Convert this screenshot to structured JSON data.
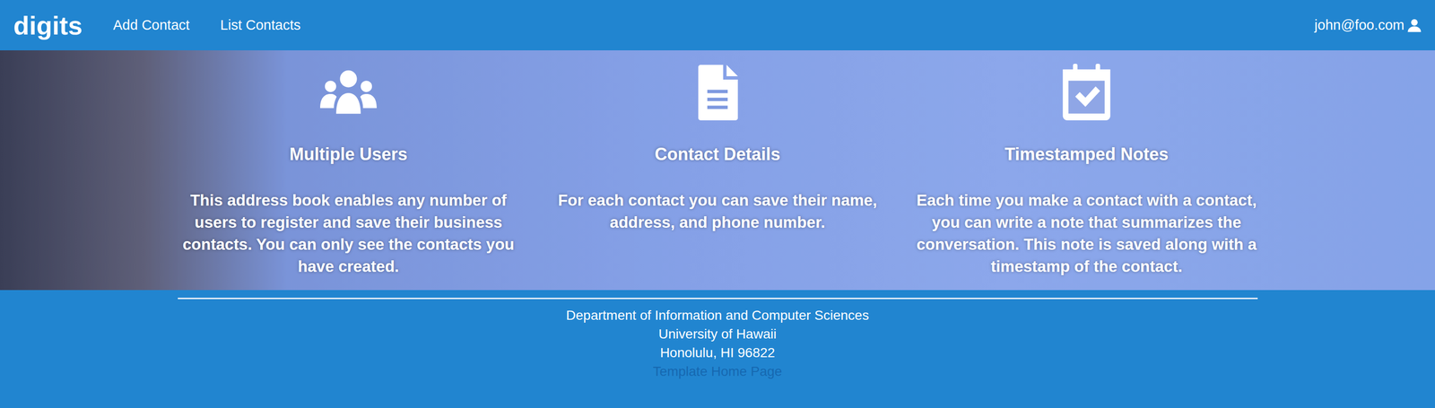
{
  "nav": {
    "brand": "digits",
    "items": [
      {
        "label": "Add Contact"
      },
      {
        "label": "List Contacts"
      }
    ],
    "user": "john@foo.com"
  },
  "features": [
    {
      "title": "Multiple Users",
      "body": "This address book enables any number of users to register and save their business contacts. You can only see the contacts you have created."
    },
    {
      "title": "Contact Details",
      "body": "For each contact you can save their name, address, and phone number."
    },
    {
      "title": "Timestamped Notes",
      "body": "Each time you make a contact with a contact, you can write a note that summarizes the conversation. This note is saved along with a timestamp of the contact."
    }
  ],
  "footer": {
    "lines": [
      "Department of Information and Computer Sciences",
      "University of Hawaii",
      "Honolulu, HI 96822"
    ],
    "link": "Template Home Page"
  }
}
